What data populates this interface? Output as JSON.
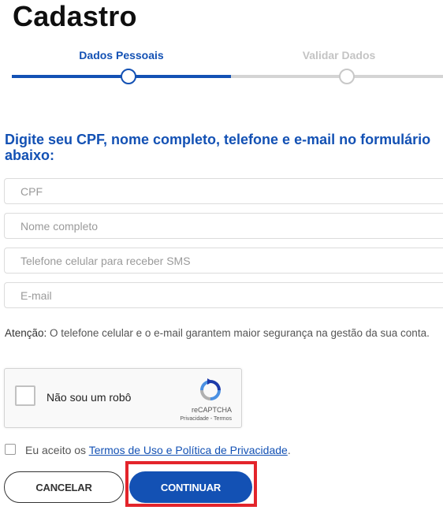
{
  "page": {
    "title": "Cadastro"
  },
  "stepper": {
    "steps": [
      {
        "label": "Dados Pessoais",
        "state": "active"
      },
      {
        "label": "Validar Dados",
        "state": "inactive"
      }
    ],
    "active_color": "#1351b4"
  },
  "form": {
    "heading": "Digite seu CPF, nome completo, telefone e e-mail no formulário abaixo:",
    "fields": [
      {
        "placeholder": "CPF",
        "value": ""
      },
      {
        "placeholder": "Nome completo",
        "value": ""
      },
      {
        "placeholder": "Telefone celular para receber SMS",
        "value": ""
      },
      {
        "placeholder": "E-mail",
        "value": ""
      }
    ],
    "notice_label": "Atenção:",
    "notice_text": " O telefone celular e o e-mail garantem maior segurança na gestão da sua conta."
  },
  "captcha": {
    "label": "Não sou um robô",
    "brand": "reCAPTCHA",
    "privacy": "Privacidade",
    "separator": " - ",
    "terms": "Termos",
    "icon": "recaptcha-logo-icon"
  },
  "accept": {
    "prefix": "Eu aceito os ",
    "link": "Termos de Uso e Política de Privacidade",
    "suffix": ".",
    "checked": false
  },
  "buttons": {
    "cancel": "CANCELAR",
    "continue": "CONTINUAR"
  },
  "colors": {
    "primary": "#1351b4",
    "highlight": "#e3242b"
  }
}
